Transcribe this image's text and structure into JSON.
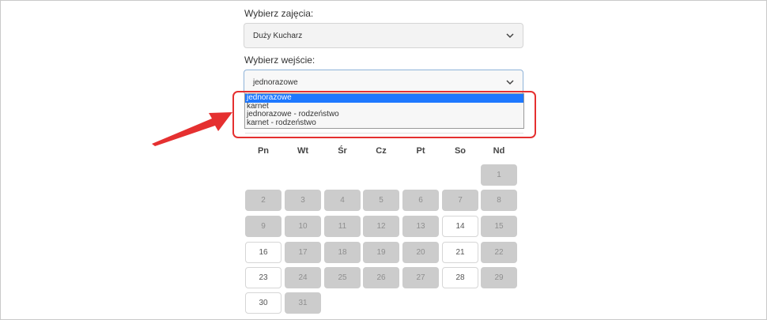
{
  "form": {
    "class_label": "Wybierz zajęcia:",
    "class_value": "Duży Kucharz",
    "entry_label": "Wybierz wejście:",
    "entry_value": "jednorazowe",
    "entry_options": [
      "jednorazowe",
      "karnet",
      "jednorazowe - rodzeństwo",
      "karnet - rodzeństwo"
    ],
    "selected_option_index": 0
  },
  "annotation": {
    "color": "#e53030"
  },
  "calendar": {
    "weekdays": [
      "Pn",
      "Wt",
      "Śr",
      "Cz",
      "Pt",
      "So",
      "Nd"
    ],
    "weeks": [
      [
        null,
        null,
        null,
        null,
        null,
        null,
        {
          "day": "1",
          "available": false
        }
      ],
      [
        {
          "day": "2",
          "available": false
        },
        {
          "day": "3",
          "available": false
        },
        {
          "day": "4",
          "available": false
        },
        {
          "day": "5",
          "available": false
        },
        {
          "day": "6",
          "available": false
        },
        {
          "day": "7",
          "available": false
        },
        {
          "day": "8",
          "available": false
        }
      ],
      [
        {
          "day": "9",
          "available": false
        },
        {
          "day": "10",
          "available": false
        },
        {
          "day": "11",
          "available": false
        },
        {
          "day": "12",
          "available": false
        },
        {
          "day": "13",
          "available": false
        },
        {
          "day": "14",
          "available": true
        },
        {
          "day": "15",
          "available": false
        }
      ],
      [
        {
          "day": "16",
          "available": true
        },
        {
          "day": "17",
          "available": false
        },
        {
          "day": "18",
          "available": false
        },
        {
          "day": "19",
          "available": false
        },
        {
          "day": "20",
          "available": false
        },
        {
          "day": "21",
          "available": true
        },
        {
          "day": "22",
          "available": false
        }
      ],
      [
        {
          "day": "23",
          "available": true
        },
        {
          "day": "24",
          "available": false
        },
        {
          "day": "25",
          "available": false
        },
        {
          "day": "26",
          "available": false
        },
        {
          "day": "27",
          "available": false
        },
        {
          "day": "28",
          "available": true
        },
        {
          "day": "29",
          "available": false
        }
      ],
      [
        {
          "day": "30",
          "available": true
        },
        {
          "day": "31",
          "available": false
        },
        null,
        null,
        null,
        null,
        null
      ]
    ]
  }
}
